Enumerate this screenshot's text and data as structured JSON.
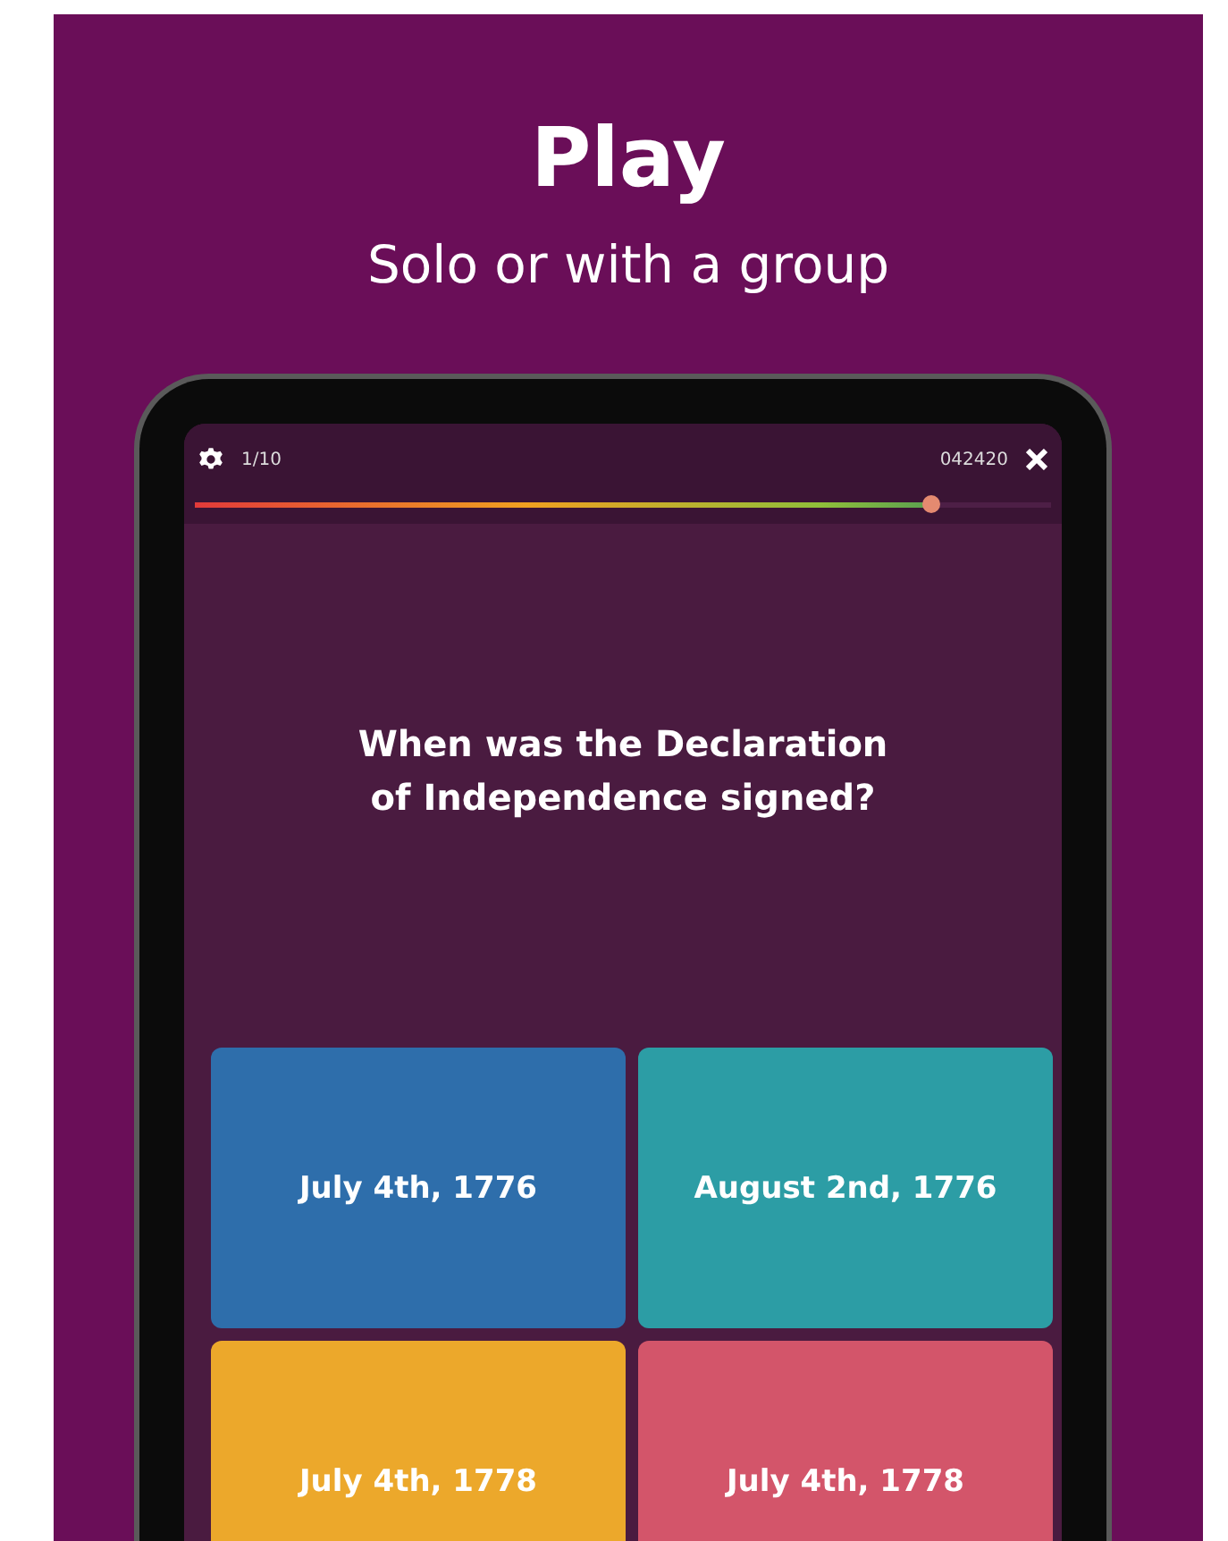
{
  "heading": "Play",
  "subheading": "Solo or with a group",
  "quiz": {
    "progress": "1/10",
    "code": "042420",
    "timer": {
      "level": 0.87
    },
    "question": "When was the Declaration of Independence signed?",
    "answers": [
      {
        "text": "July 4th, 1776",
        "color": "#2e6eab"
      },
      {
        "text": "August 2nd, 1776",
        "color": "#2c9da5"
      },
      {
        "text": "July 4th, 1778",
        "color": "#eca82b"
      },
      {
        "text": "July 4th, 1778",
        "color": "#d3556a"
      }
    ]
  }
}
